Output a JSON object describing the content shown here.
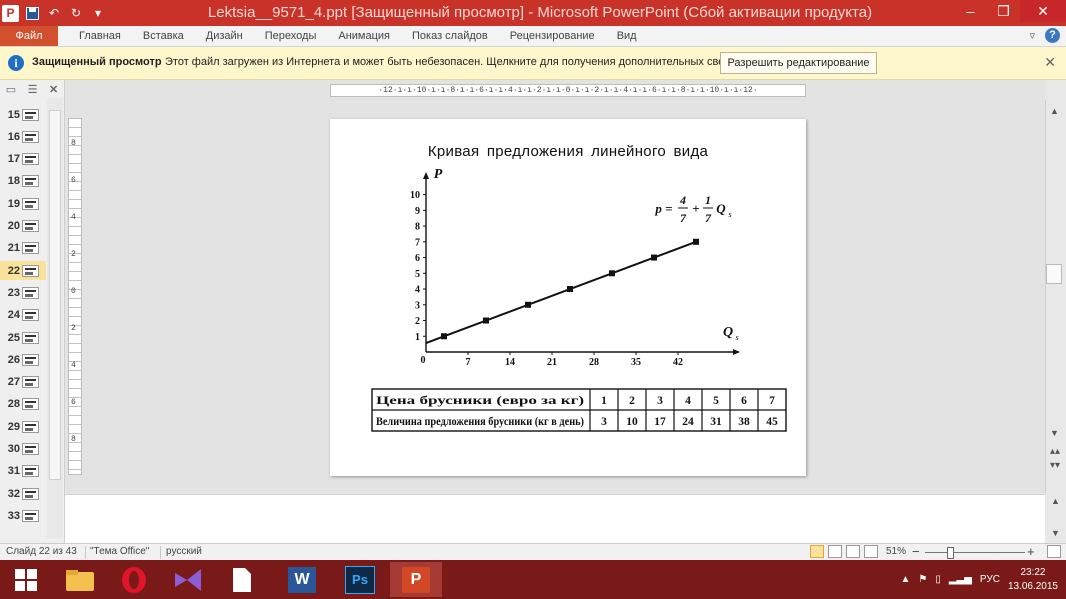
{
  "window": {
    "title": "Lektsia__9571_4.ppt [Защищенный просмотр] - Microsoft PowerPoint (Сбой активации продукта)",
    "app_logo": "P",
    "minimize": "–",
    "restore": "❐",
    "close": "✕"
  },
  "ribbon": {
    "file_tab": "Файл",
    "tabs": [
      "Главная",
      "Вставка",
      "Дизайн",
      "Переходы",
      "Анимация",
      "Показ слайдов",
      "Рецензирование",
      "Вид"
    ],
    "help": "?",
    "collapse": "▿"
  },
  "message_bar": {
    "title": "Защищенный просмотр",
    "text": "Этот файл загружен из Интернета и может быть небезопасен. Щелкните для получения дополнительных сведений.",
    "button": "Разрешить редактирование",
    "close": "✕"
  },
  "slides_panel": {
    "close": "✕",
    "slides": [
      {
        "num": "15",
        "active": false
      },
      {
        "num": "16",
        "active": false
      },
      {
        "num": "17",
        "active": false
      },
      {
        "num": "18",
        "active": false
      },
      {
        "num": "19",
        "active": false
      },
      {
        "num": "20",
        "active": false
      },
      {
        "num": "21",
        "active": false
      },
      {
        "num": "22",
        "active": true
      },
      {
        "num": "23",
        "active": false
      },
      {
        "num": "24",
        "active": false
      },
      {
        "num": "25",
        "active": false
      },
      {
        "num": "26",
        "active": false
      },
      {
        "num": "27",
        "active": false
      },
      {
        "num": "28",
        "active": false
      },
      {
        "num": "29",
        "active": false
      },
      {
        "num": "30",
        "active": false
      },
      {
        "num": "31",
        "active": false
      },
      {
        "num": "32",
        "active": false
      },
      {
        "num": "33",
        "active": false
      }
    ]
  },
  "ruler": {
    "horizontal": "·12·ı·ı·10·ı·ı·8·ı·ı·6·ı·ı·4·ı·ı·2·ı·ı·0·ı·ı·2·ı·ı·4·ı·ı·6·ı·ı·8·ı·ı·10·ı·ı·12·",
    "vertical_labels": [
      "8",
      "6",
      "4",
      "2",
      "0",
      "2",
      "4",
      "6",
      "8"
    ]
  },
  "slide": {
    "title": "Кривая предложения  линейного  вида",
    "formula": {
      "lhs": "p =",
      "n1": "4",
      "d1": "7",
      "plus": "+",
      "n2": "1",
      "d2": "7",
      "var": "Q",
      "sub": "s"
    },
    "chart": {
      "type": "line",
      "ylabel": "P",
      "xlabel": "Q",
      "xlabel_sub": "s",
      "origin_label": "0",
      "x_ticks": [
        7,
        14,
        21,
        28,
        35,
        42
      ],
      "y_ticks": [
        1,
        2,
        3,
        4,
        5,
        6,
        7,
        8,
        9,
        10
      ],
      "xlim": [
        0,
        50
      ],
      "ylim": [
        0,
        10.8
      ],
      "line_points": [
        [
          0,
          0.5714
        ],
        [
          45,
          7.0
        ]
      ],
      "markers": [
        [
          3,
          1
        ],
        [
          10,
          2
        ],
        [
          17,
          3
        ],
        [
          24,
          4
        ],
        [
          31,
          5
        ],
        [
          38,
          6
        ],
        [
          45,
          7
        ]
      ]
    },
    "table": {
      "rows": [
        {
          "label": "Цена брусники (евро за кг)",
          "values": [
            "1",
            "2",
            "3",
            "4",
            "5",
            "6",
            "7"
          ]
        },
        {
          "label": "Величина предложения брусники (кг в день)",
          "values": [
            "3",
            "10",
            "17",
            "24",
            "31",
            "38",
            "45"
          ]
        }
      ]
    }
  },
  "chart_data": {
    "type": "line",
    "title": "Кривая предложения  линейного  вида",
    "xlabel": "Qs",
    "ylabel": "P",
    "xlim": [
      0,
      50
    ],
    "ylim": [
      0,
      10
    ],
    "x_ticks": [
      7,
      14,
      21,
      28,
      35,
      42
    ],
    "y_ticks": [
      1,
      2,
      3,
      4,
      5,
      6,
      7,
      8,
      9,
      10
    ],
    "series": [
      {
        "x": [
          3,
          10,
          17,
          24,
          31,
          38,
          45
        ],
        "y": [
          1,
          2,
          3,
          4,
          5,
          6,
          7
        ]
      }
    ],
    "grid": false
  },
  "status_bar": {
    "slide_info": "Слайд 22 из 43",
    "theme": "\"Тема Office\"",
    "language": "русский",
    "zoom": "51%",
    "zoom_minus": "−",
    "zoom_plus": "+"
  },
  "taskbar": {
    "apps": [
      "start",
      "file-explorer",
      "opera",
      "visual-studio",
      "file",
      "word",
      "photoshop",
      "powerpoint"
    ],
    "word_letter": "W",
    "ps_letter": "Ps",
    "ppt_letter": "P",
    "language": "РУС",
    "time": "23:22",
    "date": "13.06.2015"
  },
  "colors": {
    "titlebar": "#c83228",
    "file_tab": "#d2502e",
    "message_bar": "#fff7cc",
    "taskbar": "#7a1a18",
    "active_slide": "#fbe29a"
  }
}
